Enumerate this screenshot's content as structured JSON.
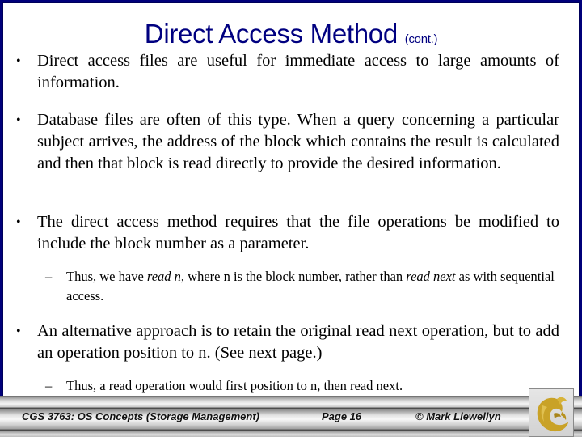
{
  "slide": {
    "title": "Direct Access Method",
    "title_suffix": "(cont.)",
    "bullets": [
      {
        "marker": "•",
        "text": "Direct  access files are useful for immediate access to large amounts of information."
      },
      {
        "marker": "•",
        "text": "Database files are often of this type.  When a query concerning a particular subject arrives, the address of the block which contains the result is calculated and then that block is read directly to provide the desired information."
      },
      {
        "marker": "•",
        "text": "The direct access method requires that the file operations be modified to include the block number as a parameter."
      },
      {
        "marker": "•",
        "text": "An alternative approach is to retain the original read next operation, but to add an operation position to n.  (See next page.)"
      }
    ],
    "subbullets": [
      {
        "marker": "–",
        "parts": [
          "Thus, we have ",
          "read n",
          ", where n is the block number, rather than ",
          "read next",
          " as with sequential access."
        ]
      },
      {
        "marker": "–",
        "text": "Thus, a read operation would first position to n, then read next."
      }
    ]
  },
  "footer": {
    "course": "CGS 3763: OS Concepts  (Storage Management)",
    "page": "Page 16",
    "copyright": "© Mark Llewellyn",
    "logo_icon": "pegasus-logo-icon"
  },
  "colors": {
    "frame": "#00007a",
    "title": "#000080",
    "logo_gold": "#c9a227"
  }
}
